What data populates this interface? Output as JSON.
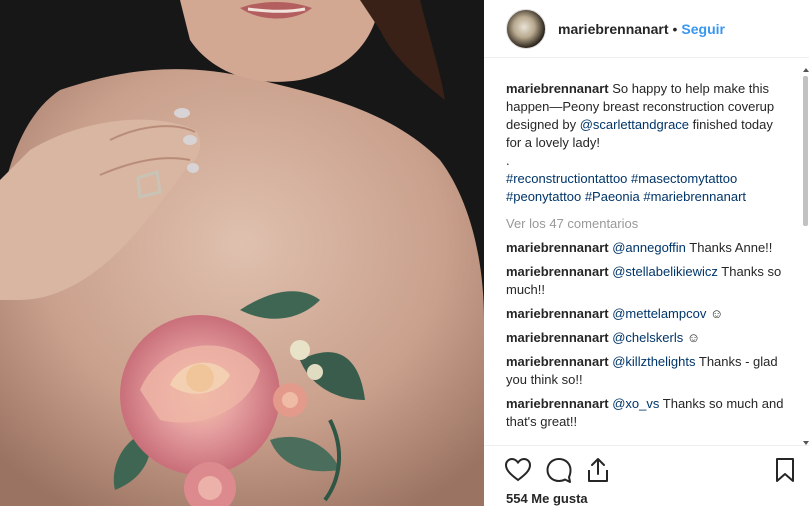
{
  "photo": {
    "alt_icon": "photo"
  },
  "header": {
    "username": "mariebrennanart",
    "separator": "•",
    "follow_label": "Seguir"
  },
  "caption": {
    "username": "mariebrennanart",
    "text_1": " So happy to help make this happen—Peony breast reconstruction coverup designed by ",
    "mention": "@scarlettandgrace",
    "text_2": " finished today for a lovely lady!",
    "dot": ".",
    "hashtags": [
      "#reconstructiontattoo",
      "#masectomytattoo",
      "#peonytattoo",
      "#Paeonia",
      "#mariebrennanart"
    ]
  },
  "view_all": "Ver los 47 comentarios",
  "comments": [
    {
      "user": "mariebrennanart",
      "mention": "@annegoffin",
      "text": " Thanks Anne!!"
    },
    {
      "user": "mariebrennanart",
      "mention": "@stellabelikiewicz",
      "text": " Thanks so much!!"
    },
    {
      "user": "mariebrennanart",
      "mention": "@mettelampcov",
      "text": " ☺"
    },
    {
      "user": "mariebrennanart",
      "mention": "@chelskerls",
      "text": " ☺"
    },
    {
      "user": "mariebrennanart",
      "mention": "@killzthelights",
      "text": " Thanks - glad you think so!!"
    },
    {
      "user": "mariebrennanart",
      "mention": "@xo_vs",
      "text": " Thanks so much and that's great!!"
    }
  ],
  "actions": {
    "like_icon": "heart-icon",
    "comment_icon": "comment-icon",
    "share_icon": "share-icon",
    "save_icon": "bookmark-icon"
  },
  "likes": "554 Me gusta",
  "colors": {
    "link": "#003569",
    "follow": "#3897f0",
    "muted": "#999999"
  }
}
